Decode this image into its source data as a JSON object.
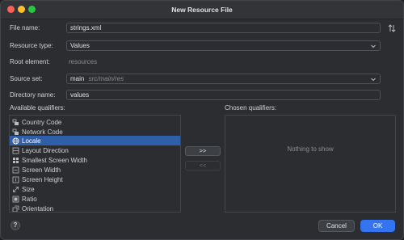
{
  "window": {
    "title": "New Resource File"
  },
  "form": {
    "file_name_label": "File name:",
    "file_name_value": "strings.xml",
    "resource_type_label": "Resource type:",
    "resource_type_value": "Values",
    "root_element_label": "Root element:",
    "root_element_value": "resources",
    "source_set_label": "Source set:",
    "source_set_name": "main",
    "source_set_path": "src/main/res",
    "directory_name_label": "Directory name:",
    "directory_name_value": "values"
  },
  "qualifiers": {
    "available_label": "Available qualifiers:",
    "chosen_label": "Chosen qualifiers:",
    "empty_text": "Nothing to show",
    "items": [
      {
        "label": "Country Code",
        "icon": "country-code-icon"
      },
      {
        "label": "Network Code",
        "icon": "network-code-icon"
      },
      {
        "label": "Locale",
        "icon": "globe-icon",
        "selected": true
      },
      {
        "label": "Layout Direction",
        "icon": "layout-direction-icon"
      },
      {
        "label": "Smallest Screen Width",
        "icon": "smallest-screen-width-icon"
      },
      {
        "label": "Screen Width",
        "icon": "screen-width-icon"
      },
      {
        "label": "Screen Height",
        "icon": "screen-height-icon"
      },
      {
        "label": "Size",
        "icon": "size-icon"
      },
      {
        "label": "Ratio",
        "icon": "ratio-icon"
      },
      {
        "label": "Orientation",
        "icon": "orientation-icon"
      }
    ],
    "add_label": ">>",
    "remove_label": "<<"
  },
  "footer": {
    "help_label": "?",
    "cancel_label": "Cancel",
    "ok_label": "OK"
  },
  "colors": {
    "selection": "#2e5fa8",
    "primary_button": "#3574f0",
    "background": "#2b2d30"
  }
}
